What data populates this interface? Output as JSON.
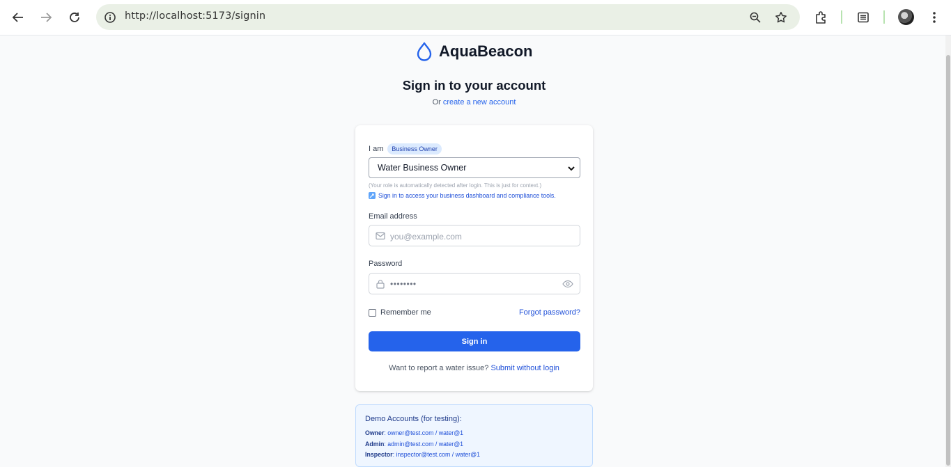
{
  "browser": {
    "url": "http://localhost:5173/signin",
    "icons": [
      "back-arrow-icon",
      "forward-arrow-icon",
      "reload-icon",
      "site-info-icon",
      "zoom-icon",
      "star-icon",
      "extensions-icon",
      "reading-list-icon",
      "profile-avatar",
      "more-vert-icon"
    ]
  },
  "brand": {
    "name": "AquaBeacon",
    "icon": "water-drop-icon",
    "color": "#2563eb"
  },
  "header": {
    "title": "Sign in to your account",
    "or_text": "Or",
    "create_link": "create a new account"
  },
  "form": {
    "role_label": "I am",
    "role_badge": "Business Owner",
    "role_select_value": "Water Business Owner",
    "role_hint": "(Your role is automatically detected after login. This is just for context.)",
    "role_info": "Sign in to access your business dashboard and compliance tools.",
    "email_label": "Email address",
    "email_placeholder": "you@example.com",
    "password_label": "Password",
    "password_masked": "••••••••",
    "remember_label": "Remember me",
    "forgot_link": "Forgot password?",
    "submit_label": "Sign in",
    "report_text": "Want to report a water issue?",
    "report_link": "Submit without login"
  },
  "demo": {
    "title": "Demo Accounts (for testing):",
    "accounts": [
      {
        "role": "Owner",
        "creds": "owner@test.com / water@1"
      },
      {
        "role": "Admin",
        "creds": "admin@test.com / water@1"
      },
      {
        "role": "Inspector",
        "creds": "inspector@test.com / water@1"
      }
    ]
  }
}
